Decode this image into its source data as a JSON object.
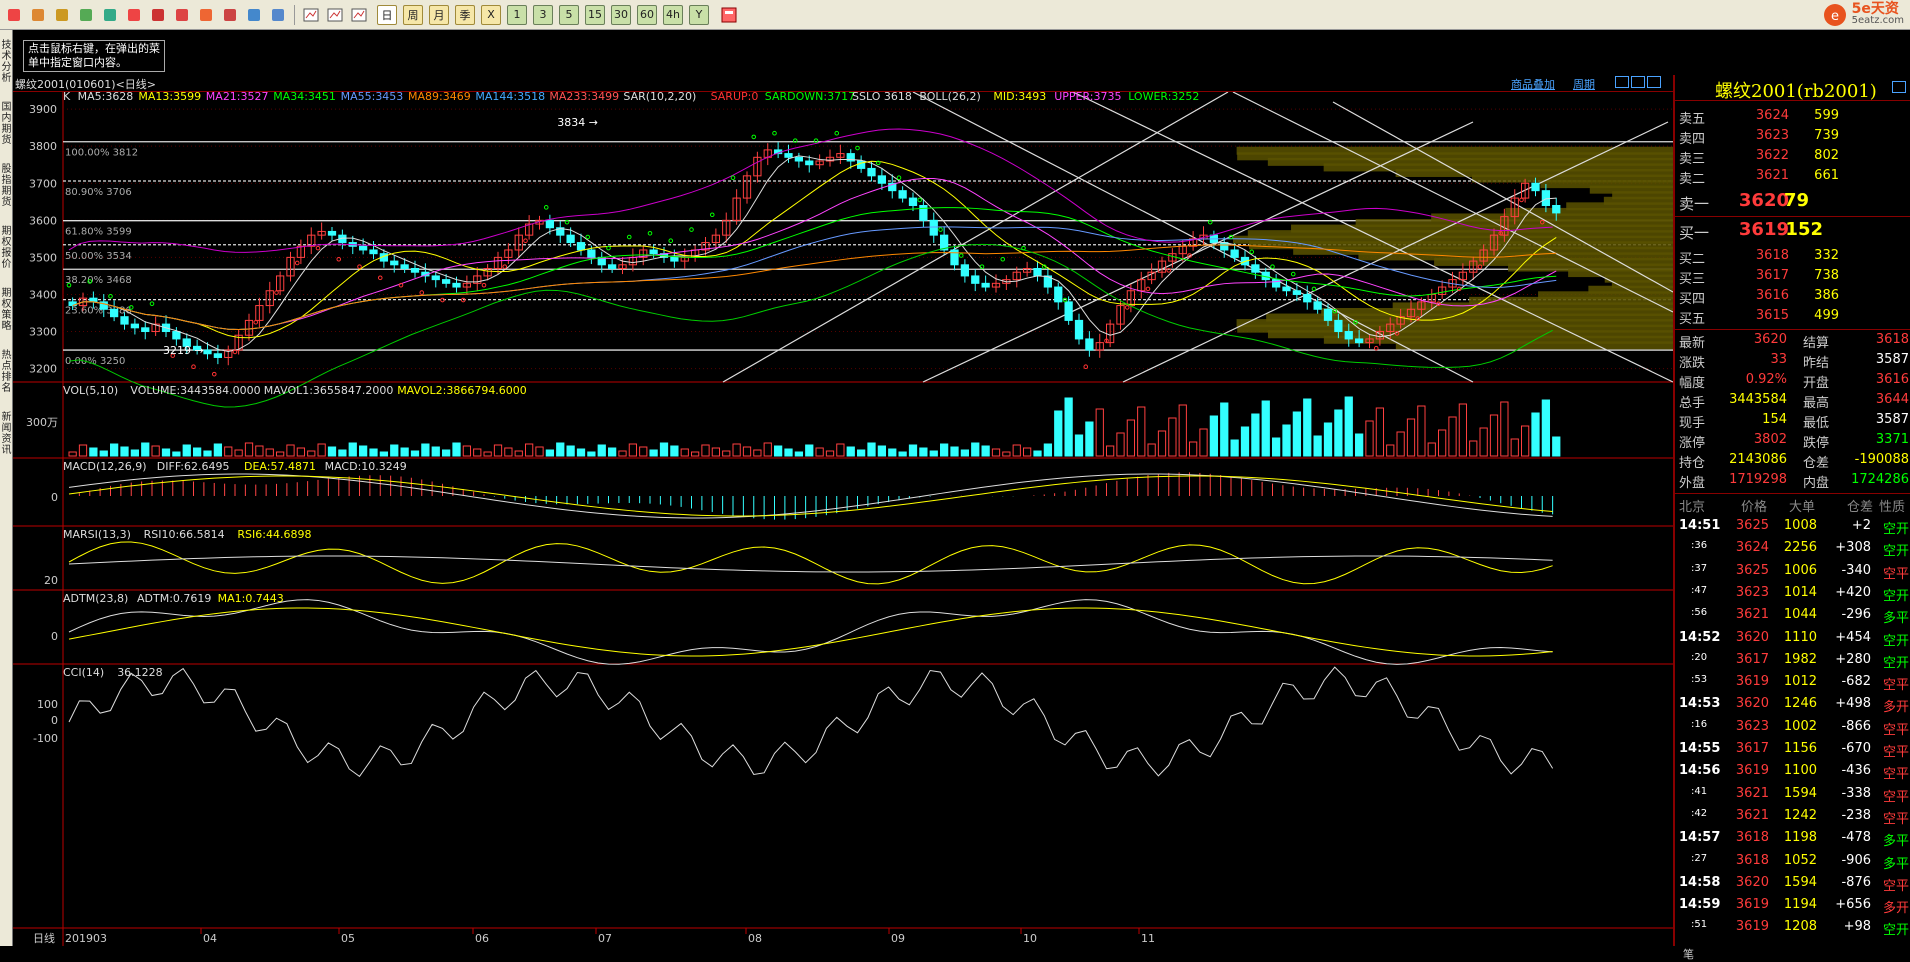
{
  "toolbar": {
    "icons": [
      "back-icon",
      "home-icon",
      "book-icon",
      "notes-icon",
      "refresh-icon",
      "zoom-in-icon",
      "zoom-out-icon",
      "pen-icon",
      "brush-icon",
      "paint-icon",
      "filter-icon",
      "indicator-icon"
    ],
    "views": [
      "table-icon",
      "line-chart-icon",
      "candle-chart-icon"
    ],
    "periods": [
      "日",
      "周",
      "月",
      "季",
      "X",
      "1",
      "3",
      "5",
      "15",
      "30",
      "60",
      "4h",
      "Y"
    ],
    "last_icon": "calculator-icon"
  },
  "logo": {
    "text": "5e天资",
    "sub": "5eatz.com"
  },
  "side_tabs": [
    "技术分析",
    "国内期货",
    "股指期货",
    "期权报价",
    "期权策略",
    "热点排名",
    "新闻资讯"
  ],
  "hint": "点击鼠标右键，在弹出的菜单中指定窗口内容。",
  "title": {
    "left": "螺纹2001(010601)<日线>",
    "links": [
      "商品叠加",
      "周期"
    ]
  },
  "indicators": {
    "k": [
      {
        "t": "K",
        "c": "#ddd"
      },
      {
        "t": "MA5:3628",
        "c": "#ddd"
      },
      {
        "t": "MA13:3599",
        "c": "#ffff00"
      },
      {
        "t": "MA21:3527",
        "c": "#ff44ff"
      },
      {
        "t": "MA34:3451",
        "c": "#00ff00"
      },
      {
        "t": "MA55:3453",
        "c": "#6699ff"
      },
      {
        "t": "MA89:3469",
        "c": "#ff8800"
      },
      {
        "t": "MA144:3518",
        "c": "#44aaff"
      },
      {
        "t": "MA233:3499",
        "c": "#ff5555"
      },
      {
        "t": "SAR(10,2,20)",
        "c": "#ddd"
      },
      {
        "t": "SARUP:0",
        "c": "#ff3333"
      },
      {
        "t": "SARDOWN:3717",
        "c": "#00ff00"
      },
      {
        "t": "SSLO 3618",
        "c": "#ddd"
      },
      {
        "t": "BOLL(26,2)",
        "c": "#ddd"
      },
      {
        "t": "MID:3493",
        "c": "#ffff00"
      },
      {
        "t": "UPPER:3735",
        "c": "#ff44ff"
      },
      {
        "t": "LOWER:3252",
        "c": "#00ff00"
      }
    ],
    "vol": [
      {
        "t": "VOL(5,10)",
        "c": "#ddd"
      },
      {
        "t": "VOLUME:3443584.0000",
        "c": "#ddd"
      },
      {
        "t": "MAVOL1:3655847.2000",
        "c": "#ddd"
      },
      {
        "t": "MAVOL2:3866794.6000",
        "c": "#ffff00"
      }
    ],
    "macd": [
      {
        "t": "MACD(12,26,9)",
        "c": "#ddd"
      },
      {
        "t": "DIFF:62.6495",
        "c": "#ddd"
      },
      {
        "t": "DEA:57.4871",
        "c": "#ffff00"
      },
      {
        "t": "MACD:10.3249",
        "c": "#ddd"
      }
    ],
    "rsi": [
      {
        "t": "MARSI(13,3)",
        "c": "#ddd"
      },
      {
        "t": "RSI10:66.5814",
        "c": "#ddd"
      },
      {
        "t": "RSI6:44.6898",
        "c": "#ffff00"
      }
    ],
    "adtm": [
      {
        "t": "ADTM(23,8)",
        "c": "#ddd"
      },
      {
        "t": "ADTM:0.7619",
        "c": "#ddd"
      },
      {
        "t": "MA1:0.7443",
        "c": "#ffff00"
      }
    ],
    "cci": [
      {
        "t": "CCI(14)",
        "c": "#ddd"
      },
      {
        "t": "36.1228",
        "c": "#ddd"
      }
    ]
  },
  "price_axis": [
    "3900",
    "3800",
    "3700",
    "3600",
    "3500",
    "3400",
    "3300",
    "3200"
  ],
  "fib": [
    "100.00% 3812",
    "80.90% 3706",
    "61.80% 3599",
    "50.00% 3534",
    "38.20% 3468",
    "23.60% 3386",
    "0.00% 3250"
  ],
  "price_marks": {
    "high": "3834",
    "low": "3219"
  },
  "vol_axis": [
    "300万"
  ],
  "macd_axis": [
    "0"
  ],
  "rsi_axis": [
    "20"
  ],
  "adtm_axis": [
    "0"
  ],
  "cci_axis": [
    "100",
    "0",
    "-100"
  ],
  "x_axis": {
    "prefix": "日线",
    "labels": [
      "201903",
      "04",
      "05",
      "06",
      "07",
      "08",
      "09",
      "10",
      "11"
    ]
  },
  "chart_data": {
    "type": "candlestick",
    "ylim": [
      3180,
      3930
    ],
    "close": [
      3370,
      3390,
      3380,
      3360,
      3340,
      3320,
      3310,
      3300,
      3320,
      3300,
      3280,
      3260,
      3250,
      3240,
      3230,
      3250,
      3290,
      3330,
      3370,
      3410,
      3450,
      3500,
      3530,
      3560,
      3570,
      3560,
      3540,
      3530,
      3520,
      3510,
      3490,
      3480,
      3470,
      3460,
      3450,
      3440,
      3430,
      3420,
      3430,
      3450,
      3470,
      3500,
      3520,
      3560,
      3590,
      3600,
      3580,
      3560,
      3540,
      3520,
      3500,
      3480,
      3470,
      3480,
      3500,
      3520,
      3510,
      3500,
      3490,
      3500,
      3520,
      3540,
      3560,
      3600,
      3660,
      3720,
      3770,
      3790,
      3780,
      3770,
      3760,
      3750,
      3760,
      3770,
      3780,
      3760,
      3740,
      3720,
      3700,
      3680,
      3660,
      3640,
      3600,
      3560,
      3520,
      3480,
      3450,
      3430,
      3420,
      3430,
      3440,
      3460,
      3470,
      3450,
      3420,
      3380,
      3330,
      3280,
      3250,
      3270,
      3320,
      3370,
      3410,
      3440,
      3460,
      3490,
      3510,
      3530,
      3550,
      3560,
      3540,
      3520,
      3500,
      3480,
      3460,
      3440,
      3420,
      3410,
      3400,
      3380,
      3360,
      3330,
      3300,
      3280,
      3270,
      3280,
      3300,
      3320,
      3340,
      3360,
      3380,
      3400,
      3420,
      3440,
      3460,
      3490,
      3520,
      3560,
      3610,
      3660,
      3700,
      3680,
      3640,
      3620
    ]
  },
  "quote": {
    "title": "螺纹2001(rb2001)",
    "sells": [
      {
        "l": "卖五",
        "p": "3624",
        "v": "599"
      },
      {
        "l": "卖四",
        "p": "3623",
        "v": "739"
      },
      {
        "l": "卖三",
        "p": "3622",
        "v": "802"
      },
      {
        "l": "卖二",
        "p": "3621",
        "v": "661"
      }
    ],
    "sell1": {
      "l": "卖一",
      "p": "3620",
      "v": "79"
    },
    "buy1": {
      "l": "买一",
      "p": "3619",
      "v": "152"
    },
    "buys": [
      {
        "l": "买二",
        "p": "3618",
        "v": "332"
      },
      {
        "l": "买三",
        "p": "3617",
        "v": "738"
      },
      {
        "l": "买四",
        "p": "3616",
        "v": "386"
      },
      {
        "l": "买五",
        "p": "3615",
        "v": "499"
      }
    ],
    "stats": [
      {
        "l1": "最新",
        "v1": "3620",
        "c1": "red",
        "l2": "结算",
        "v2": "3618",
        "c2": "red"
      },
      {
        "l1": "涨跌",
        "v1": "33",
        "c1": "red",
        "l2": "昨结",
        "v2": "3587",
        "c2": "wht"
      },
      {
        "l1": "幅度",
        "v1": "0.92%",
        "c1": "red",
        "l2": "开盘",
        "v2": "3616",
        "c2": "red"
      },
      {
        "l1": "总手",
        "v1": "3443584",
        "c1": "yel",
        "l2": "最高",
        "v2": "3644",
        "c2": "red"
      },
      {
        "l1": "现手",
        "v1": "154",
        "c1": "yel",
        "l2": "最低",
        "v2": "3587",
        "c2": "wht"
      },
      {
        "l1": "涨停",
        "v1": "3802",
        "c1": "red",
        "l2": "跌停",
        "v2": "3371",
        "c2": "grn"
      },
      {
        "l1": "持仓",
        "v1": "2143086",
        "c1": "yel",
        "l2": "仓差",
        "v2": "-190088",
        "c2": "yel"
      },
      {
        "l1": "外盘",
        "v1": "1719298",
        "c1": "red",
        "l2": "内盘",
        "v2": "1724286",
        "c2": "grn"
      }
    ],
    "tick_header": [
      "北京",
      "价格",
      "大单",
      "仓差",
      "性质"
    ],
    "ticks": [
      {
        "t": "14:51",
        "p": "3625",
        "v": "1008",
        "d": "+2",
        "n": "空开",
        "nc": "grn"
      },
      {
        "t": ":36",
        "p": "3624",
        "v": "2256",
        "d": "+308",
        "n": "空开",
        "nc": "grn"
      },
      {
        "t": ":37",
        "p": "3625",
        "v": "1006",
        "d": "-340",
        "n": "空平",
        "nc": "red"
      },
      {
        "t": ":47",
        "p": "3623",
        "v": "1014",
        "d": "+420",
        "n": "空开",
        "nc": "grn"
      },
      {
        "t": ":56",
        "p": "3621",
        "v": "1044",
        "d": "-296",
        "n": "多平",
        "nc": "grn"
      },
      {
        "t": "14:52",
        "p": "3620",
        "v": "1110",
        "d": "+454",
        "n": "空开",
        "nc": "grn"
      },
      {
        "t": ":20",
        "p": "3617",
        "v": "1982",
        "d": "+280",
        "n": "空开",
        "nc": "grn"
      },
      {
        "t": ":53",
        "p": "3619",
        "v": "1012",
        "d": "-682",
        "n": "空平",
        "nc": "red"
      },
      {
        "t": "14:53",
        "p": "3620",
        "v": "1246",
        "d": "+498",
        "n": "多开",
        "nc": "red"
      },
      {
        "t": ":16",
        "p": "3623",
        "v": "1002",
        "d": "-866",
        "n": "空平",
        "nc": "red"
      },
      {
        "t": "14:55",
        "p": "3617",
        "v": "1156",
        "d": "-670",
        "n": "空平",
        "nc": "red"
      },
      {
        "t": "14:56",
        "p": "3619",
        "v": "1100",
        "d": "-436",
        "n": "空平",
        "nc": "red"
      },
      {
        "t": ":41",
        "p": "3621",
        "v": "1594",
        "d": "-338",
        "n": "空平",
        "nc": "red"
      },
      {
        "t": ":42",
        "p": "3621",
        "v": "1242",
        "d": "-238",
        "n": "空平",
        "nc": "red"
      },
      {
        "t": "14:57",
        "p": "3618",
        "v": "1198",
        "d": "-478",
        "n": "多平",
        "nc": "grn"
      },
      {
        "t": ":27",
        "p": "3618",
        "v": "1052",
        "d": "-906",
        "n": "多平",
        "nc": "grn"
      },
      {
        "t": "14:58",
        "p": "3620",
        "v": "1594",
        "d": "-876",
        "n": "空平",
        "nc": "red"
      },
      {
        "t": "14:59",
        "p": "3619",
        "v": "1194",
        "d": "+656",
        "n": "多开",
        "nc": "red"
      },
      {
        "t": ":51",
        "p": "3619",
        "v": "1208",
        "d": "+98",
        "n": "空开",
        "nc": "grn"
      }
    ],
    "footer": "笔"
  }
}
